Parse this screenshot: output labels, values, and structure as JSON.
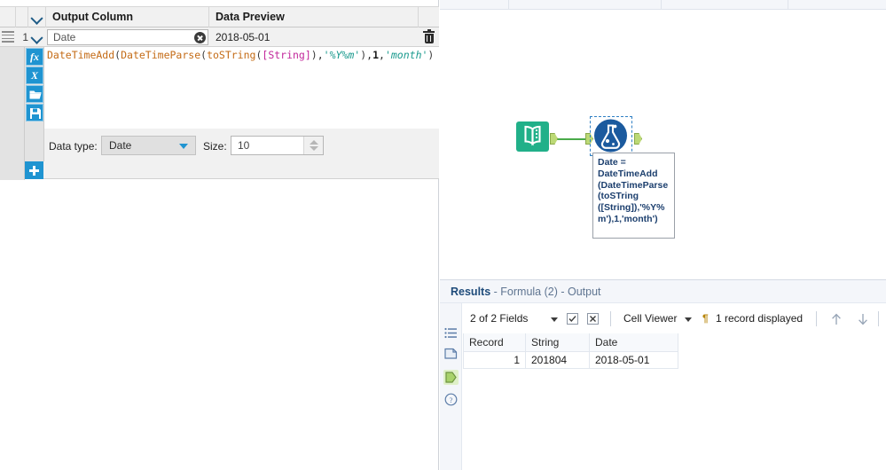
{
  "config": {
    "headers": {
      "output_column": "Output Column",
      "data_preview": "Data Preview"
    },
    "row": {
      "number": "1",
      "output_column_value": "Date",
      "data_preview_value": "2018-05-01"
    },
    "icons": {
      "function": "fx",
      "variable": "X",
      "open": "folder-open-icon",
      "save": "floppy-save-icon"
    },
    "formula": {
      "full_text": "DateTimeAdd(DateTimeParse(toSTring([String]),'%Y%m'),1,'month')",
      "tokens": [
        {
          "t": "DateTimeAdd",
          "c": "fn"
        },
        {
          "t": "(",
          "c": "paren"
        },
        {
          "t": "DateTimeParse",
          "c": "fn"
        },
        {
          "t": "(",
          "c": "paren"
        },
        {
          "t": "toSTring",
          "c": "fn"
        },
        {
          "t": "(",
          "c": "paren"
        },
        {
          "t": "[String]",
          "c": "fld"
        },
        {
          "t": ")",
          "c": "paren"
        },
        {
          "t": ",",
          "c": "punc"
        },
        {
          "t": "'%Y%m'",
          "c": "str"
        },
        {
          "t": ")",
          "c": "paren"
        },
        {
          "t": ",",
          "c": "punc"
        },
        {
          "t": "1",
          "c": "num"
        },
        {
          "t": ",",
          "c": "punc"
        },
        {
          "t": "'month'",
          "c": "str"
        },
        {
          "t": ")",
          "c": "paren"
        }
      ]
    },
    "data_type": {
      "label": "Data type:",
      "value": "Date",
      "options": [
        "Date"
      ]
    },
    "size": {
      "label": "Size:",
      "value": "10"
    },
    "add_row_label": "+"
  },
  "canvas": {
    "nodes": [
      {
        "name": "text-input-tool",
        "icon": "book-icon"
      },
      {
        "name": "formula-tool",
        "icon": "flask-icon",
        "selected": true
      }
    ],
    "annotation_lines": [
      "Date =",
      "DateTimeAdd",
      "(DateTimeParse",
      "(toSTring",
      "([String]),'%Y%",
      "m'),1,'month')"
    ]
  },
  "results": {
    "title_main": "Results",
    "title_sub": "- Formula (2) - Output",
    "toolbar": {
      "fields_label": "2 of 2 Fields",
      "select_all_icon": "checkbox-checked-icon",
      "deselect_all_icon": "checkbox-x-icon",
      "viewer_label": "Cell Viewer",
      "pilcrow_icon": "pilcrow-icon",
      "record_count": "1 record displayed",
      "prev_icon": "arrow-up-icon",
      "next_icon": "arrow-down-icon"
    },
    "side_icons": [
      "list-icon",
      "metadata-icon",
      "output-anchor-icon",
      "help-icon"
    ],
    "table": {
      "columns": [
        "Record",
        "String",
        "Date"
      ],
      "rows": [
        {
          "record": "1",
          "string": "201804",
          "date": "2018-05-01"
        }
      ]
    }
  },
  "colors": {
    "accent_blue": "#1f94d1",
    "tool_green": "#21b089",
    "tool_blue": "#1b5a9e",
    "connector_green": "#4aab4a",
    "selection_blue": "#2e7fc4"
  }
}
